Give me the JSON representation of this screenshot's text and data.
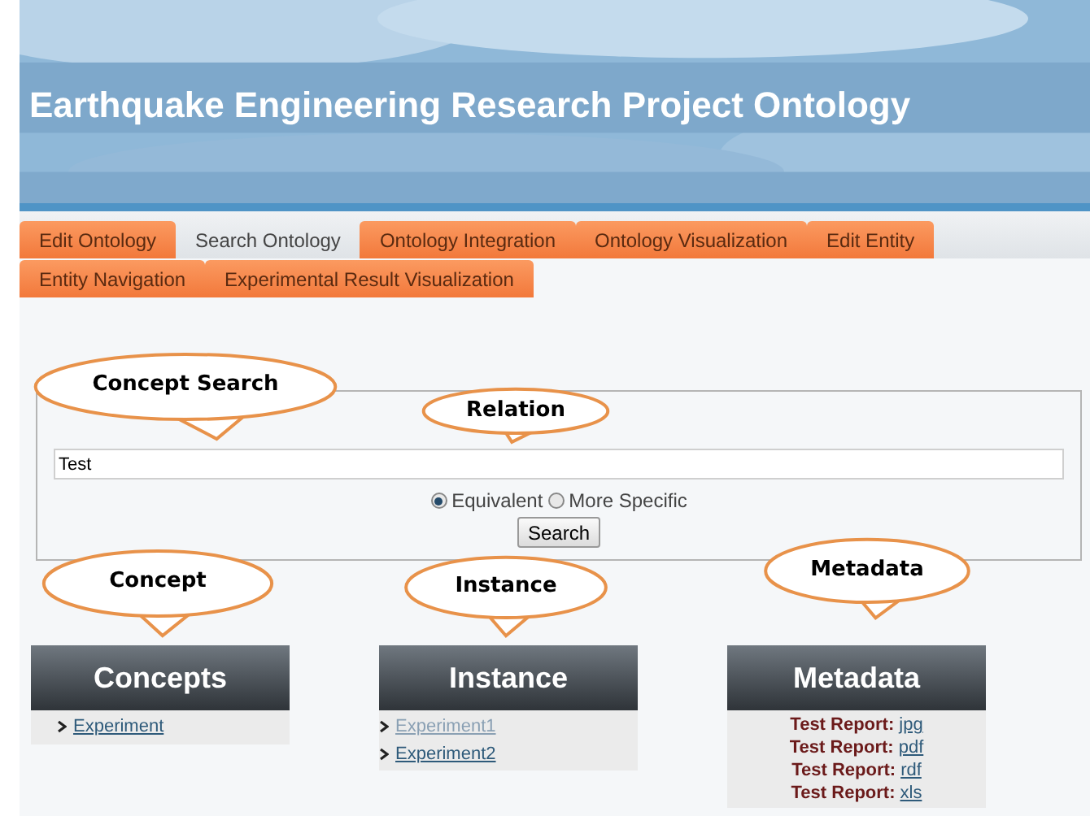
{
  "header": {
    "title": "Earthquake Engineering Research Project Ontology"
  },
  "tabs": [
    {
      "label": "Edit Ontology",
      "selected": false
    },
    {
      "label": "Search Ontology",
      "selected": true
    },
    {
      "label": "Ontology Integration",
      "selected": false
    },
    {
      "label": "Ontology Visualization",
      "selected": false
    },
    {
      "label": "Edit Entity",
      "selected": false
    },
    {
      "label": "Entity Navigation",
      "selected": false
    },
    {
      "label": "Experimental Result Visualization",
      "selected": false
    }
  ],
  "search": {
    "value": "Test",
    "options": [
      {
        "label": "Equivalent",
        "selected": true
      },
      {
        "label": "More Specific",
        "selected": false
      }
    ],
    "button": "Search"
  },
  "callouts": [
    {
      "text": "Concept Search"
    },
    {
      "text": "Relation"
    },
    {
      "text": "Concept"
    },
    {
      "text": "Instance"
    },
    {
      "text": "Metadata"
    }
  ],
  "panels": [
    {
      "title": "Concepts",
      "kind": "links",
      "items": [
        {
          "label": "Experiment",
          "visited": false
        }
      ]
    },
    {
      "title": "Instance",
      "kind": "links",
      "items": [
        {
          "label": "Experiment1",
          "visited": true
        },
        {
          "label": "Experiment2",
          "visited": false
        }
      ]
    },
    {
      "title": "Metadata",
      "kind": "reports",
      "items": [
        {
          "prefix": "Test Report:",
          "label": "jpg"
        },
        {
          "prefix": "Test Report:",
          "label": "pdf"
        },
        {
          "prefix": "Test Report:",
          "label": "rdf"
        },
        {
          "prefix": "Test Report:",
          "label": "xls"
        }
      ]
    }
  ]
}
